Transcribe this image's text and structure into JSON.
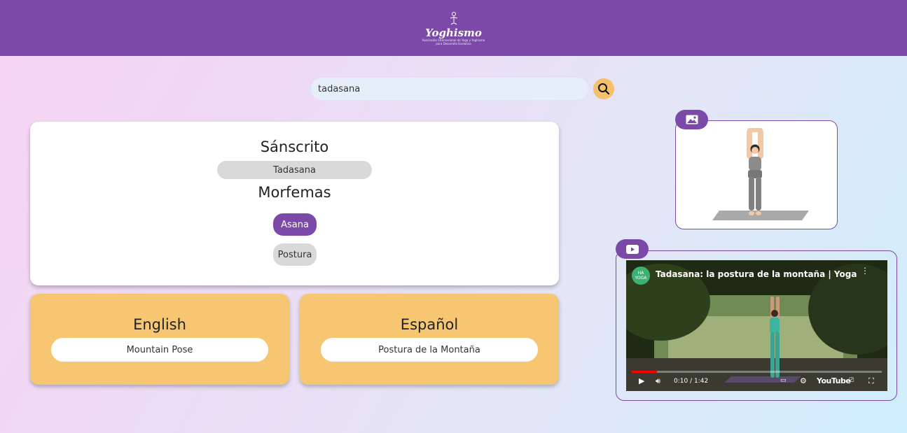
{
  "header": {
    "logo_word": "Yoghismo",
    "logo_tagline": "Asociación Internacional de Yoga y Yoghismo para Desarrollo Evolutivo"
  },
  "search": {
    "value": "tadasana",
    "icon": "search-icon"
  },
  "sanskrit": {
    "title": "Sánscrito",
    "value": "Tadasana",
    "morphemes_title": "Morfemas",
    "morphemes": [
      "Asana",
      "Postura"
    ]
  },
  "english": {
    "title": "English",
    "value": "Mountain Pose"
  },
  "spanish": {
    "title": "Español",
    "value": "Postura de la Montaña"
  },
  "media": {
    "image_icon": "image-icon",
    "video_icon": "youtube-icon"
  },
  "video": {
    "title": "Tadasana: la postura de la montaña | Yoga",
    "channel": "HA YOGA",
    "time": "0:10 / 1:42",
    "brand": "YouTube",
    "progress": 0.1
  },
  "colors": {
    "primary": "#7b4aa8",
    "accent": "#f7c673",
    "pill_gray": "#d9d9d9"
  }
}
